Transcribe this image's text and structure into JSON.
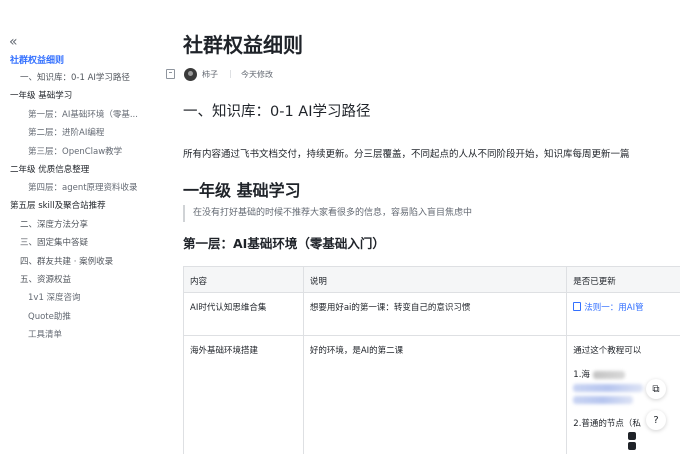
{
  "sidebar": {
    "collapse_icon": "«",
    "items": [
      {
        "label": "社群权益细则",
        "level": "active"
      },
      {
        "label": "一、知识库：0-1 AI学习路径",
        "level": "l2"
      },
      {
        "label": "一年级 基础学习",
        "level": "l1"
      },
      {
        "label": "第一层：AI基础环境（零基...",
        "level": "l3"
      },
      {
        "label": "第二层：进阶AI编程",
        "level": "l3"
      },
      {
        "label": "第三层：OpenClaw教学",
        "level": "l3"
      },
      {
        "label": "二年级 优质信息整理",
        "level": "l1"
      },
      {
        "label": "第四层：agent原理资料收录",
        "level": "l3"
      },
      {
        "label": "第五层 skill及聚合站推荐",
        "level": "l1"
      },
      {
        "label": "二、深度方法分享",
        "level": "l2"
      },
      {
        "label": "三、固定集中答疑",
        "level": "l2"
      },
      {
        "label": "四、群友共建 · 案例收录",
        "level": "l2"
      },
      {
        "label": "五、资源权益",
        "level": "l2"
      },
      {
        "label": "1v1 深度咨询",
        "level": "l3"
      },
      {
        "label": "Quote助推",
        "level": "l3"
      },
      {
        "label": "工具清单",
        "level": "l3"
      }
    ]
  },
  "doc": {
    "title": "社群权益细则",
    "author": "柿子",
    "modified": "今天修改",
    "heading1": "一、知识库：0-1 AI学习路径",
    "paragraph": "所有内容通过飞书文档交付，持续更新。分三层覆盖，不同起点的人从不同阶段开始，知识库每周更新一篇",
    "heading_grade1": "一年级 基础学习",
    "quote": "在没有打好基础的时候不推荐大家看很多的信息，容易陷入盲目焦虑中",
    "heading_layer1": "第一层：AI基础环境（零基础入门）"
  },
  "table": {
    "headers": [
      "内容",
      "说明",
      "是否已更新"
    ],
    "rows": [
      {
        "content": "AI时代认知思维合集",
        "desc": "想要用好ai的第一课：转变自己的意识习惯",
        "status": "法则一：用AI管"
      },
      {
        "content": "海外基础环境搭建",
        "desc": "好的环境，是AI的第二课",
        "status_lines": [
          "通过这个教程可以",
          "1.海",
          "2.普通的节点（私"
        ]
      }
    ]
  },
  "floating": {
    "btn1_icon": "⧉",
    "btn2_icon": "?"
  }
}
